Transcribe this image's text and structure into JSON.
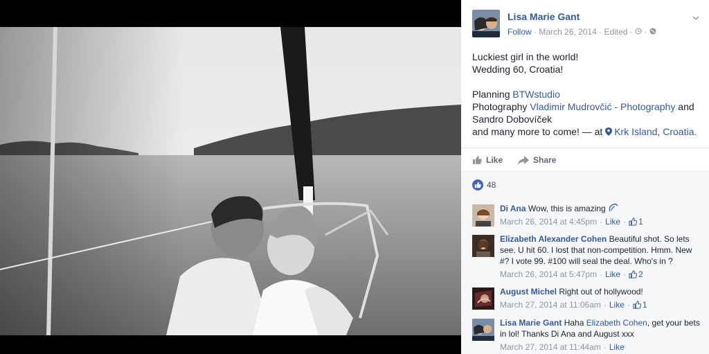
{
  "photo": {
    "alt_name": "wedding-photo"
  },
  "post": {
    "author": "Lisa Marie Gant",
    "follow": "Follow",
    "date": "March 26, 2014",
    "edited": "Edited",
    "line1": "Luckiest girl in the world!",
    "line2": "Wedding 60, Croatia!",
    "planning_label": "Planning ",
    "planning_link": "BTWstudio",
    "photography_label": "Photography ",
    "photography_link": "Vladimir Mudrovčić - Photography",
    "and": " and",
    "photographer2": "Sandro Dobovíček",
    "closing": "and many more to come! — at ",
    "location": "Krk Island, Croatia."
  },
  "actions": {
    "like": "Like",
    "share": "Share"
  },
  "reactions": {
    "count": "48"
  },
  "colors": {
    "link": "#365899",
    "meta": "#90949c",
    "like_blue": "#4267b2"
  },
  "comments": [
    {
      "name": "Di Ana",
      "text": "Wow, this is amazing",
      "time": "March 26, 2014 at 4:45pm",
      "like": "Like",
      "likes": "1"
    },
    {
      "name": "Elizabeth Alexander Cohen",
      "text": "Beautiful shot. So lets see. U hit 60. I lost that non-competition. Hmm. New #? I vote 99. #100 will seal the deal. Who's in ?",
      "time": "March 26, 2014 at 5:47pm",
      "like": "Like",
      "likes": "2"
    },
    {
      "name": "August Michel",
      "text": "Right out of hollywood!",
      "time": "March 27, 2014 at 11:06am",
      "like": "Like",
      "likes": "1"
    },
    {
      "name": "Lisa Marie Gant",
      "text_pre": "Haha ",
      "mention": "Elizabeth Cohen",
      "text_post": ", get your bets in lol! Thanks Di Ana and August xxx",
      "time": "March 27, 2014 at 11:44am",
      "like": "Like"
    }
  ]
}
